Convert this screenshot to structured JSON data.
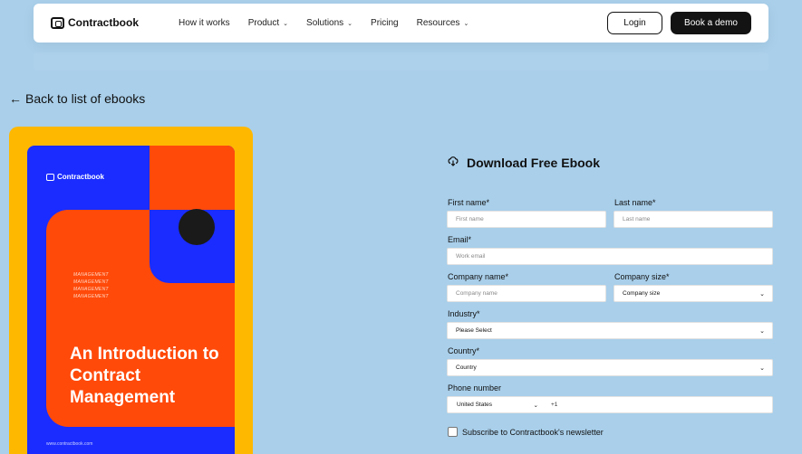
{
  "nav": {
    "logo": "Contractbook",
    "links": [
      {
        "label": "How it works",
        "dropdown": false
      },
      {
        "label": "Product",
        "dropdown": true
      },
      {
        "label": "Solutions",
        "dropdown": true
      },
      {
        "label": "Pricing",
        "dropdown": false
      },
      {
        "label": "Resources",
        "dropdown": true
      }
    ],
    "login": "Login",
    "demo": "Book a demo"
  },
  "back": {
    "label": "Back to list of ebooks"
  },
  "ebook": {
    "logo": "Contractbook",
    "tags": [
      "MANAGEMENT",
      "MANAGEMENT",
      "MANAGEMENT",
      "MANAGEMENT"
    ],
    "title": "An Introduction to Contract Management",
    "url": "www.contractbook.com",
    "colors": {
      "frame": "#ffb800",
      "blue": "#1a2cff",
      "orange": "#ff4a0a"
    }
  },
  "form": {
    "title": "Download Free Ebook",
    "first_name": {
      "label": "First name*",
      "placeholder": "First name"
    },
    "last_name": {
      "label": "Last name*",
      "placeholder": "Last name"
    },
    "email": {
      "label": "Email*",
      "placeholder": "Work email"
    },
    "company_name": {
      "label": "Company name*",
      "placeholder": "Company name"
    },
    "company_size": {
      "label": "Company size*",
      "value": "Company size"
    },
    "industry": {
      "label": "Industry*",
      "value": "Please Select"
    },
    "country": {
      "label": "Country*",
      "value": "Country"
    },
    "phone": {
      "label": "Phone number",
      "country": "United States",
      "code": "+1"
    },
    "newsletter": {
      "label": "Subscribe to Contractbook's newsletter"
    }
  }
}
